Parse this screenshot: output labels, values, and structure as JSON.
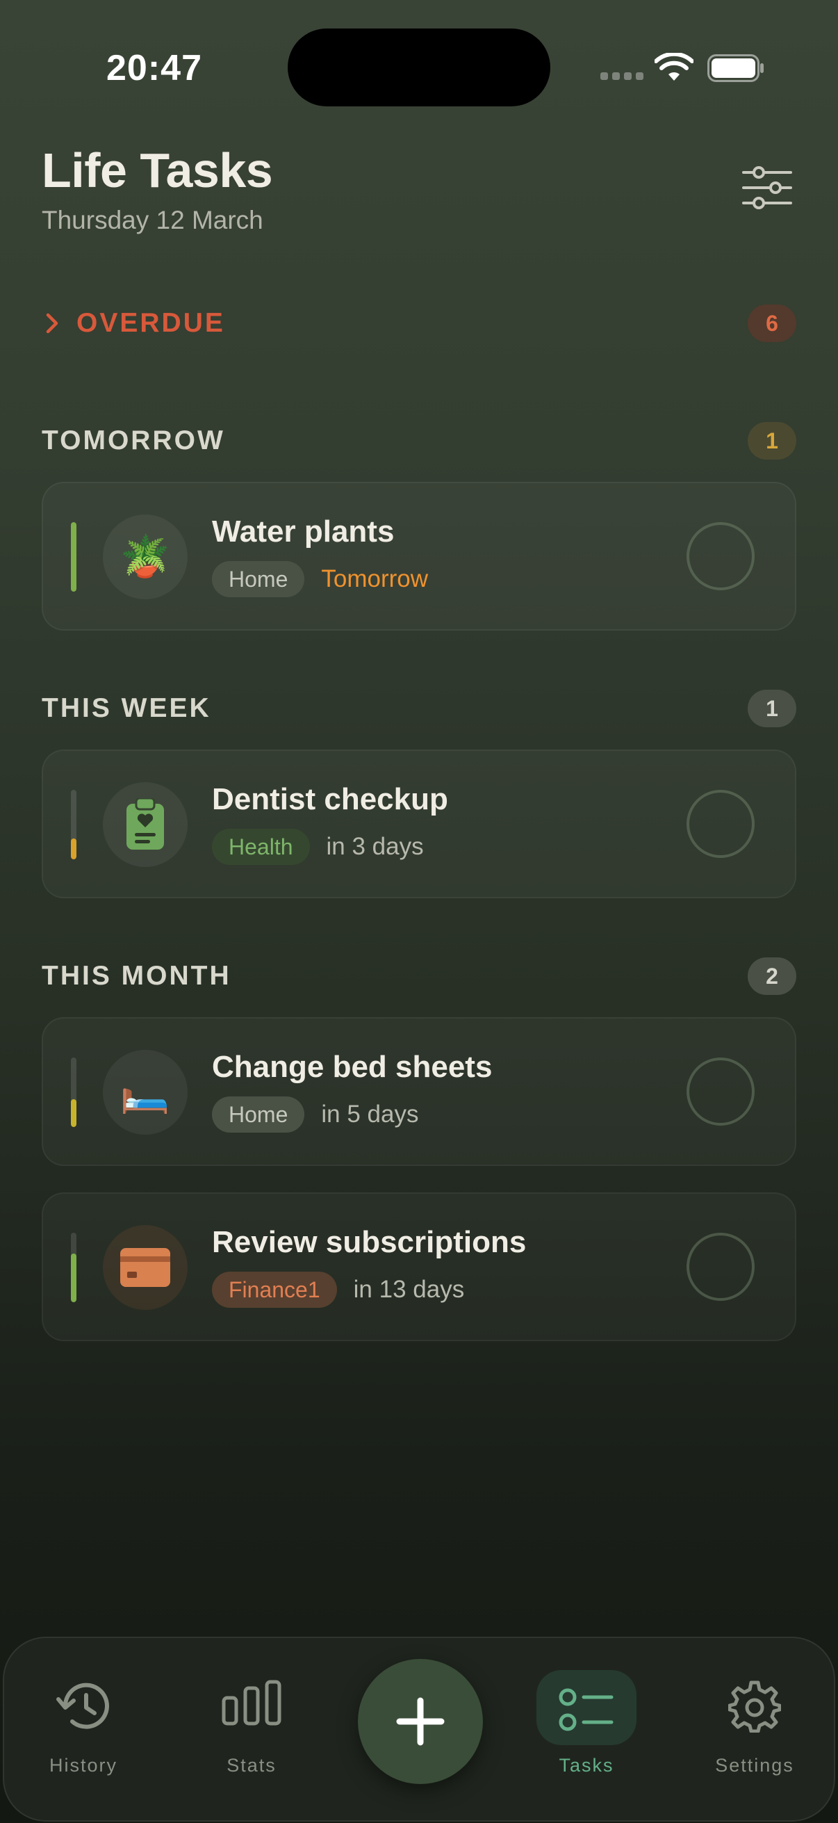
{
  "status_bar": {
    "time": "20:47"
  },
  "header": {
    "title": "Life Tasks",
    "date": "Thursday 12 March"
  },
  "sections": {
    "overdue": {
      "title": "OVERDUE",
      "count": "6"
    },
    "tomorrow": {
      "title": "TOMORROW",
      "count": "1",
      "tasks": [
        {
          "name": "Water plants",
          "category": "Home",
          "due": "Tomorrow",
          "icon": "potted-plant-icon",
          "icon_glyph": "🪴",
          "priority_color": "#7fb04a",
          "priority_level": 1.0
        }
      ]
    },
    "this_week": {
      "title": "THIS WEEK",
      "count": "1",
      "tasks": [
        {
          "name": "Dentist checkup",
          "category": "Health",
          "due": "in 3 days",
          "icon": "clipboard-heart-icon",
          "priority_color": "#d9a22a",
          "priority_level": 0.3
        }
      ]
    },
    "this_month": {
      "title": "THIS MONTH",
      "count": "2",
      "tasks": [
        {
          "name": "Change bed sheets",
          "category": "Home",
          "due": "in 5 days",
          "icon": "bed-icon",
          "icon_glyph": "🛏️",
          "priority_color": "#c7b42c",
          "priority_level": 0.6
        },
        {
          "name": "Review subscriptions",
          "category": "Finance1",
          "due": "in 13 days",
          "icon": "credit-card-icon",
          "priority_color": "#7fb04a",
          "priority_level": 0.7
        }
      ]
    }
  },
  "tab_bar": {
    "history": "History",
    "stats": "Stats",
    "tasks": "Tasks",
    "settings": "Settings",
    "active": "tasks"
  },
  "colors": {
    "accent_green": "#64b089",
    "overdue_red": "#d8593b",
    "tomorrow_orange": "#f0922e"
  }
}
